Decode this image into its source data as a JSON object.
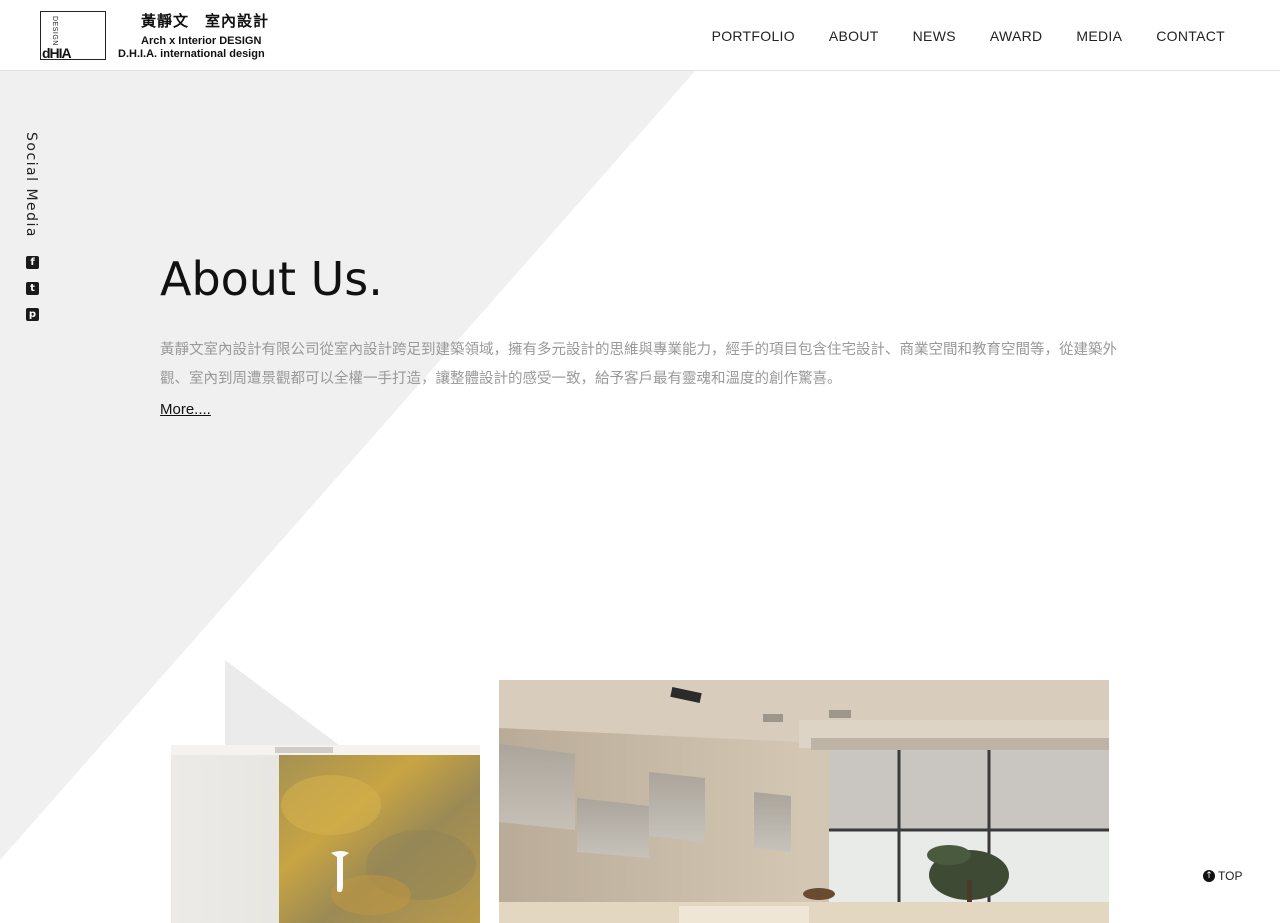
{
  "logo": {
    "vertical_text": "DESIGN",
    "mark_text": "dHIA",
    "name_zh": "黃靜文　室內設計",
    "tagline_1": "Arch x Interior DESIGN",
    "tagline_2": "D.H.I.A. international design"
  },
  "nav": {
    "items": [
      {
        "label": "PORTFOLIO"
      },
      {
        "label": "ABOUT"
      },
      {
        "label": "NEWS"
      },
      {
        "label": "AWARD"
      },
      {
        "label": "MEDIA"
      },
      {
        "label": "CONTACT"
      }
    ]
  },
  "social": {
    "label": "Social Media",
    "icons": [
      "facebook-icon",
      "twitter-icon",
      "pinterest-icon"
    ]
  },
  "about": {
    "title": "About Us.",
    "body": "黃靜文室內設計有限公司從室內設計跨足到建築領域，擁有多元設計的思維與專業能力，經手的項目包含住宅設計、商業空間和教育空間等，從建築外觀、室內到周遭景觀都可以全權一手打造，讓整體設計的感受一致，給予客戶最有靈魂和溫度的創作驚喜。",
    "more_label": "More...."
  },
  "top_button": {
    "label": "TOP",
    "icon": "arrow-up-circle-icon"
  },
  "colors": {
    "background": "#ffffff",
    "shape_gray": "#f0f0f0",
    "text_dark": "#111111",
    "text_muted": "#999999"
  }
}
